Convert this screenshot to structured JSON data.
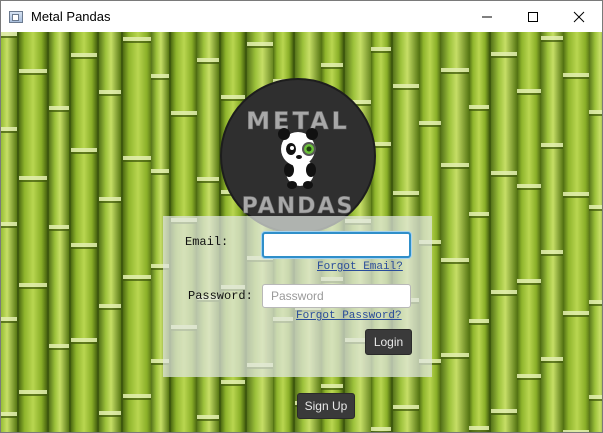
{
  "window": {
    "title": "Metal Pandas",
    "app_icon": "window-app-icon",
    "controls": [
      "minimize-icon",
      "maximize-icon",
      "close-icon"
    ]
  },
  "logo": {
    "text_top": "METAL",
    "text_bottom": "PANDAS",
    "image": "panda-logo"
  },
  "login": {
    "email_label": "Email:",
    "email_value": "",
    "forgot_email": "Forgot Email?",
    "password_label": "Password:",
    "password_placeholder": "Password",
    "forgot_password": "Forgot Password?",
    "login_button": "Login"
  },
  "signup_button": "Sign Up",
  "colors": {
    "bamboo_light": "#a4c83a",
    "bamboo_dark": "#5e7d16",
    "button_bg": "#3a3a3a",
    "link": "#2a4d9a",
    "focus": "#2f8fc9"
  }
}
